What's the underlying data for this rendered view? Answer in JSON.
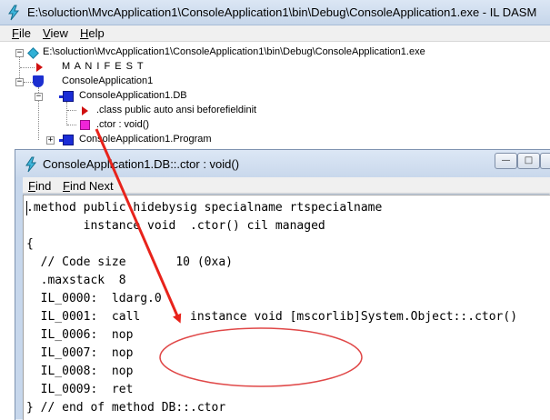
{
  "main_window": {
    "title": "E:\\soluction\\MvcApplication1\\ConsoleApplication1\\bin\\Debug\\ConsoleApplication1.exe - IL DASM",
    "menu": [
      "File",
      "View",
      "Help"
    ],
    "app_icon": "ildasm-lightning-icon"
  },
  "tree": {
    "root": "E:\\soluction\\MvcApplication1\\ConsoleApplication1\\bin\\Debug\\ConsoleApplication1.exe",
    "manifest": "M A N I F E S T",
    "namespace": "ConsoleApplication1",
    "class_db": "ConsoleApplication1.DB",
    "class_attr": ".class public auto ansi beforefieldinit",
    "ctor": ".ctor : void()",
    "class_program": "ConsoleApplication1.Program"
  },
  "child_window": {
    "title": "ConsoleApplication1.DB::.ctor : void()",
    "menu": [
      "Find",
      "Find Next"
    ],
    "buttons": {
      "minimize": "—",
      "maximize": "□",
      "close": ""
    }
  },
  "code": [
    ".method public hidebysig specialname rtspecialname",
    "        instance void  .ctor() cil managed",
    "{",
    "  // Code size       10 (0xa)",
    "  .maxstack  8",
    "  IL_0000:  ldarg.0",
    "  IL_0001:  call       instance void [mscorlib]System.Object::.ctor()",
    "  IL_0006:  nop",
    "  IL_0007:  nop",
    "  IL_0008:  nop",
    "  IL_0009:  ret",
    "} // end of method DB::.ctor"
  ],
  "annotation": {
    "arrow_color": "#e8231b",
    "ellipse_color": "#e04848"
  }
}
